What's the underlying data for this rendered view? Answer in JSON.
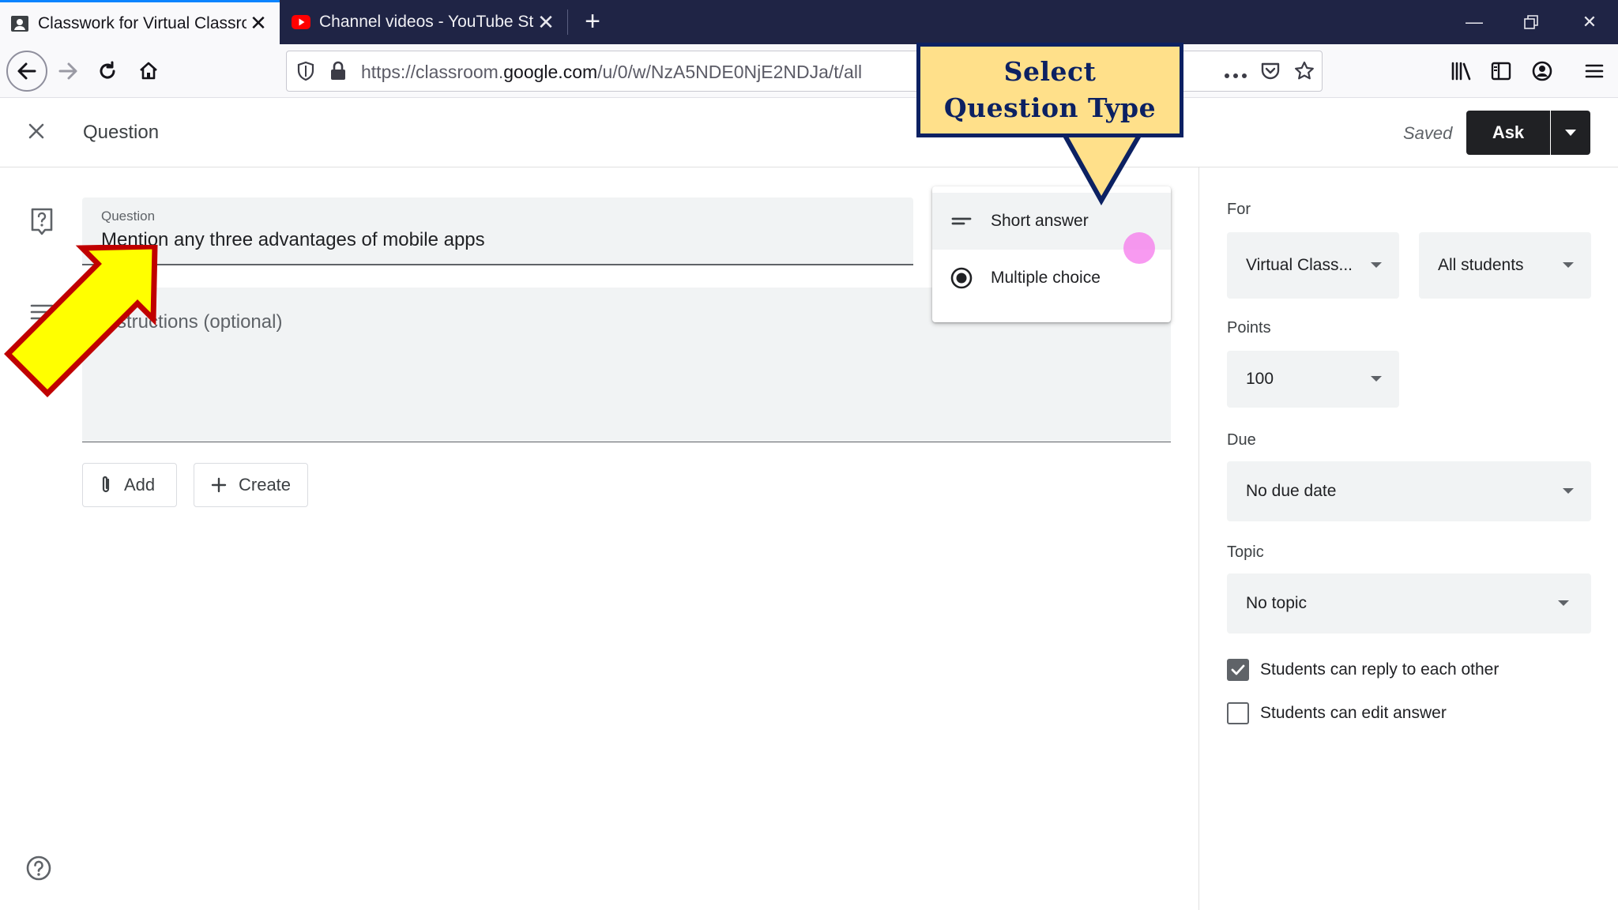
{
  "browser": {
    "tabs": [
      {
        "title": "Classwork for Virtual Classroom",
        "active": true,
        "favicon": "classroom-icon"
      },
      {
        "title": "Channel videos - YouTube Studio",
        "active": false,
        "favicon": "youtube-icon"
      }
    ],
    "url": {
      "prefix": "https://classroom.",
      "domain": "google.com",
      "path": "/u/0/w/NzA5NDE0NjE2NDJa/t/all"
    }
  },
  "header": {
    "title": "Question",
    "saved": "Saved",
    "ask_label": "Ask"
  },
  "form": {
    "question_label": "Question",
    "question_value": "Mention any three advantages of mobile apps",
    "instructions_placeholder": "Instructions (optional)",
    "add_label": "Add",
    "create_label": "Create"
  },
  "question_type_menu": {
    "items": [
      {
        "label": "Short answer",
        "icon": "short-answer-icon"
      },
      {
        "label": "Multiple choice",
        "icon": "radio-icon"
      }
    ]
  },
  "callout": {
    "line1": "Select",
    "line2": "Question Type"
  },
  "right_panel": {
    "for_label": "For",
    "class_value": "Virtual Class...",
    "students_value": "All students",
    "points_label": "Points",
    "points_value": "100",
    "due_label": "Due",
    "due_value": "No due date",
    "topic_label": "Topic",
    "topic_value": "No topic",
    "reply_label": "Students can reply to each other",
    "reply_checked": true,
    "edit_label": "Students can edit answer",
    "edit_checked": false
  },
  "colors": {
    "callout_fill": "#ffe08a",
    "callout_border": "#0c2162",
    "arrow_fill": "#ffff00",
    "arrow_border": "#c00000",
    "cursor": "#f678ec"
  }
}
